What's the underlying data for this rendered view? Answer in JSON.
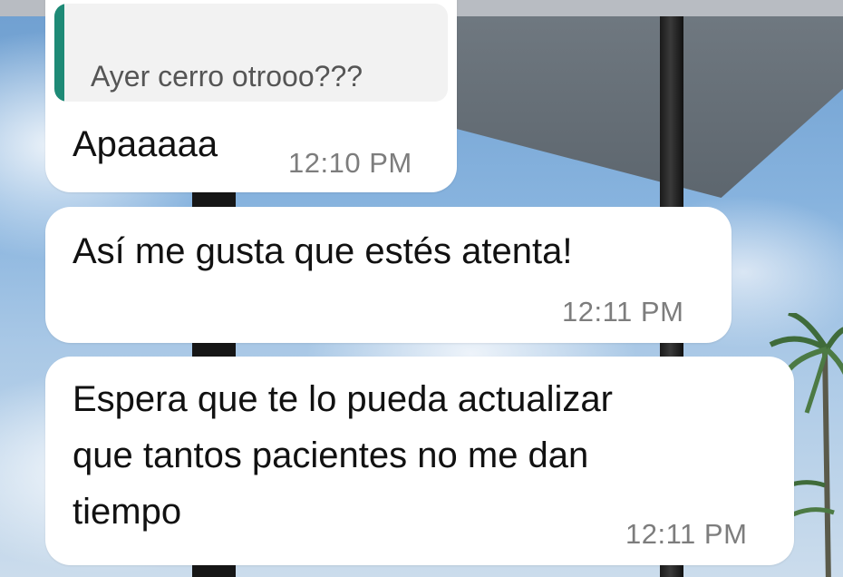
{
  "chat": {
    "messages": [
      {
        "quoted": "Ayer cerro otrooo???",
        "text": "Apaaaaa",
        "time": "12:10 PM"
      },
      {
        "text": "Así me gusta que estés atenta!",
        "time": "12:11 PM"
      },
      {
        "text": "Espera que te lo pueda actualizar\nque tantos pacientes no me dan\ntiempo",
        "time": "12:11 PM"
      }
    ]
  },
  "colors": {
    "bubble": "#ffffff",
    "quote_accent": "#1e8a76",
    "quote_background": "#f2f2f2",
    "timestamp": "#7d7d7d",
    "text": "#111111"
  }
}
